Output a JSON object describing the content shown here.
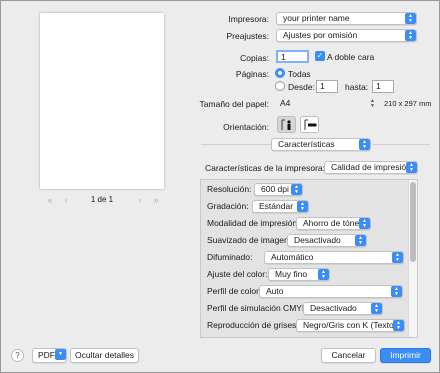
{
  "preview": {
    "page_indicator": "1 de 1",
    "nav": {
      "first": "«",
      "prev": "‹",
      "next": "›",
      "last": "»"
    }
  },
  "printer": {
    "label": "Impresora:",
    "value": "your printer name"
  },
  "presets": {
    "label": "Preajustes:",
    "value": "Ajustes por omisión"
  },
  "copies": {
    "label": "Copias:",
    "value": "1",
    "duplex_label": "A doble cara",
    "duplex_checked": true
  },
  "pages": {
    "label": "Páginas:",
    "all_label": "Todas",
    "all_selected": true,
    "from_label": "Desde:",
    "from_value": "1",
    "to_label": "hasta:",
    "to_value": "1"
  },
  "paper_size": {
    "label": "Tamaño del papel:",
    "value": "A4",
    "dimensions": "210 x 297 mm"
  },
  "orientation": {
    "label": "Orientación:",
    "selected": "portrait"
  },
  "section_popup": {
    "value": "Características"
  },
  "features": {
    "label": "Características de la impresora:",
    "value": "Calidad de impresión",
    "rows": [
      {
        "label": "Resolución:",
        "value": "600 dpi"
      },
      {
        "label": "Gradación:",
        "value": "Estándar"
      },
      {
        "label": "Modalidad de impresión:",
        "value": "Ahorro de tóner"
      },
      {
        "label": "Suavizado de imagen:",
        "value": "Desactivado"
      },
      {
        "label": "Difuminado:",
        "value": "Automático"
      },
      {
        "label": "Ajuste del color:",
        "value": "Muy fino"
      },
      {
        "label": "Perfil de color:",
        "value": "Auto"
      },
      {
        "label": "Perfil de simulación CMYK:",
        "value": "Desactivado"
      },
      {
        "label": "Reproducción de grises:",
        "value": "Negro/Gris con K (Texto..."
      }
    ]
  },
  "bottom": {
    "help": "?",
    "pdf": "PDF",
    "hide_details": "Ocultar detalles",
    "cancel": "Cancelar",
    "print": "Imprimir"
  },
  "colors": {
    "accent": "#3b8df6",
    "window_bg": "#ececec",
    "panel_bg": "#e3e3e3"
  }
}
